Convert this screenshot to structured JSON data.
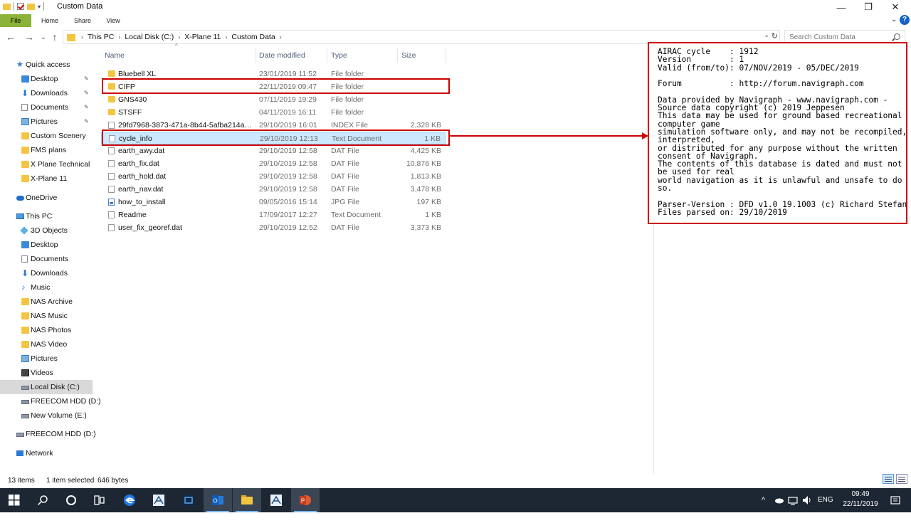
{
  "window": {
    "title": "Custom Data",
    "minimize": "—",
    "maximize": "❐",
    "close": "✕"
  },
  "ribbon": {
    "tabs": [
      "File",
      "Home",
      "Share",
      "View"
    ],
    "expand_glyph": "⌄",
    "help": "?"
  },
  "address": {
    "back": "←",
    "forward": "→",
    "recent": "⌄",
    "up": "↑",
    "crumbs": [
      "This PC",
      "Local Disk (C:)",
      "X-Plane 11",
      "Custom Data"
    ],
    "separator": "›",
    "dropdown": "⌄",
    "refresh": "↻",
    "search_placeholder": "Search Custom Data"
  },
  "nav": {
    "items": [
      {
        "label": "Quick access",
        "icon": "star-icon",
        "indent": 1,
        "pinned": false,
        "selected": false
      },
      {
        "label": "Desktop",
        "icon": "desktop-icon",
        "indent": 2,
        "pinned": true,
        "selected": false
      },
      {
        "label": "Downloads",
        "icon": "download-icon",
        "indent": 2,
        "pinned": true,
        "selected": false
      },
      {
        "label": "Documents",
        "icon": "documents-icon",
        "indent": 2,
        "pinned": true,
        "selected": false
      },
      {
        "label": "Pictures",
        "icon": "pictures-icon",
        "indent": 2,
        "pinned": true,
        "selected": false
      },
      {
        "label": "Custom Scenery",
        "icon": "folder-icon",
        "indent": 2,
        "pinned": false,
        "selected": false
      },
      {
        "label": "FMS plans",
        "icon": "folder-icon",
        "indent": 2,
        "pinned": false,
        "selected": false
      },
      {
        "label": "X Plane Technical",
        "icon": "folder-icon",
        "indent": 2,
        "pinned": false,
        "selected": false
      },
      {
        "label": "X-Plane 11",
        "icon": "folder-icon",
        "indent": 2,
        "pinned": false,
        "selected": false
      },
      {
        "label": "OneDrive",
        "icon": "cloud-icon",
        "indent": 1,
        "pinned": false,
        "selected": false
      },
      {
        "label": "This PC",
        "icon": "computer-icon",
        "indent": 1,
        "pinned": false,
        "selected": false
      },
      {
        "label": "3D Objects",
        "icon": "3d-objects-icon",
        "indent": 2,
        "pinned": false,
        "selected": false
      },
      {
        "label": "Desktop",
        "icon": "desktop-icon",
        "indent": 2,
        "pinned": false,
        "selected": false
      },
      {
        "label": "Documents",
        "icon": "documents-icon",
        "indent": 2,
        "pinned": false,
        "selected": false
      },
      {
        "label": "Downloads",
        "icon": "download-icon",
        "indent": 2,
        "pinned": false,
        "selected": false
      },
      {
        "label": "Music",
        "icon": "music-icon",
        "indent": 2,
        "pinned": false,
        "selected": false
      },
      {
        "label": "NAS Archive",
        "icon": "folder-icon",
        "indent": 2,
        "pinned": false,
        "selected": false
      },
      {
        "label": "NAS Music",
        "icon": "folder-icon",
        "indent": 2,
        "pinned": false,
        "selected": false
      },
      {
        "label": "NAS Photos",
        "icon": "folder-icon",
        "indent": 2,
        "pinned": false,
        "selected": false
      },
      {
        "label": "NAS Video",
        "icon": "folder-icon",
        "indent": 2,
        "pinned": false,
        "selected": false
      },
      {
        "label": "Pictures",
        "icon": "pictures-icon",
        "indent": 2,
        "pinned": false,
        "selected": false
      },
      {
        "label": "Videos",
        "icon": "videos-icon",
        "indent": 2,
        "pinned": false,
        "selected": false
      },
      {
        "label": "Local Disk (C:)",
        "icon": "drive-icon",
        "indent": 2,
        "pinned": false,
        "selected": true
      },
      {
        "label": "FREECOM HDD (D:)",
        "icon": "drive-icon",
        "indent": 2,
        "pinned": false,
        "selected": false
      },
      {
        "label": "New Volume (E:)",
        "icon": "drive-icon",
        "indent": 2,
        "pinned": false,
        "selected": false
      },
      {
        "label": "FREECOM HDD (D:)",
        "icon": "drive-icon",
        "indent": 1,
        "pinned": false,
        "selected": false
      },
      {
        "label": "Network",
        "icon": "network-icon",
        "indent": 1,
        "pinned": false,
        "selected": false
      }
    ]
  },
  "files": {
    "columns": [
      "Name",
      "Date modified",
      "Type",
      "Size"
    ],
    "rows": [
      {
        "name": "Bluebell XL",
        "date": "23/01/2019 11:52",
        "type": "File folder",
        "size": "",
        "icon": "folder-icon",
        "selected": false
      },
      {
        "name": "CIFP",
        "date": "22/11/2019 09:47",
        "type": "File folder",
        "size": "",
        "icon": "folder-icon",
        "selected": false
      },
      {
        "name": "GNS430",
        "date": "07/11/2019 19:29",
        "type": "File folder",
        "size": "",
        "icon": "folder-icon",
        "selected": false
      },
      {
        "name": "STSFF",
        "date": "04/11/2019 16:11",
        "type": "File folder",
        "size": "",
        "icon": "folder-icon",
        "selected": false
      },
      {
        "name": "29fd7968-3873-471a-8b44-5afba214a3d...",
        "date": "29/10/2019 16:01",
        "type": "INDEX File",
        "size": "2,328 KB",
        "icon": "file-icon",
        "selected": false
      },
      {
        "name": "cycle_info",
        "date": "29/10/2019 12:13",
        "type": "Text Document",
        "size": "1 KB",
        "icon": "file-icon",
        "selected": true
      },
      {
        "name": "earth_awy.dat",
        "date": "29/10/2019 12:58",
        "type": "DAT File",
        "size": "4,425 KB",
        "icon": "file-icon",
        "selected": false
      },
      {
        "name": "earth_fix.dat",
        "date": "29/10/2019 12:58",
        "type": "DAT File",
        "size": "10,876 KB",
        "icon": "file-icon",
        "selected": false
      },
      {
        "name": "earth_hold.dat",
        "date": "29/10/2019 12:58",
        "type": "DAT File",
        "size": "1,813 KB",
        "icon": "file-icon",
        "selected": false
      },
      {
        "name": "earth_nav.dat",
        "date": "29/10/2019 12:58",
        "type": "DAT File",
        "size": "3,478 KB",
        "icon": "file-icon",
        "selected": false
      },
      {
        "name": "how_to_install",
        "date": "09/05/2016 15:14",
        "type": "JPG File",
        "size": "197 KB",
        "icon": "image-icon",
        "selected": false
      },
      {
        "name": "Readme",
        "date": "17/09/2017 12:27",
        "type": "Text Document",
        "size": "1 KB",
        "icon": "file-icon",
        "selected": false
      },
      {
        "name": "user_fix_georef.dat",
        "date": "29/10/2019 12:52",
        "type": "DAT File",
        "size": "3,373 KB",
        "icon": "file-icon",
        "selected": false
      }
    ]
  },
  "preview": {
    "text": "AIRAC cycle    : 1912\nVersion        : 1\nValid (from/to): 07/NOV/2019 - 05/DEC/2019\n\nForum          : http://forum.navigraph.com\n\nData provided by Navigraph - www.navigraph.com -\nSource data copyright (c) 2019 Jeppesen\nThis data may be used for ground based recreational\ncomputer game\nsimulation software only, and may not be recompiled,\ninterpreted,\nor distributed for any purpose without the written\nconsent of Navigraph.\nThe contents of this database is dated and must not\nbe used for real\nworld navigation as it is unlawful and unsafe to do\nso.\n\nParser-Version : DFD v1.0 19.1003 (c) Richard Stefan\nFiles parsed on: 29/10/2019"
  },
  "status": {
    "items": "13 items",
    "selection": "1 item selected",
    "size": "646 bytes"
  },
  "taskbar": {
    "apps": [
      "start-icon",
      "search-icon",
      "cortana-icon",
      "task-view-icon",
      "edge-icon",
      "xplane-icon",
      "app-icon",
      "outlook-icon",
      "file-explorer-icon",
      "xplane-icon",
      "powerpoint-icon"
    ],
    "tray_chevron": "^",
    "language": "ENG",
    "time": "09:49",
    "date": "22/11/2019"
  }
}
